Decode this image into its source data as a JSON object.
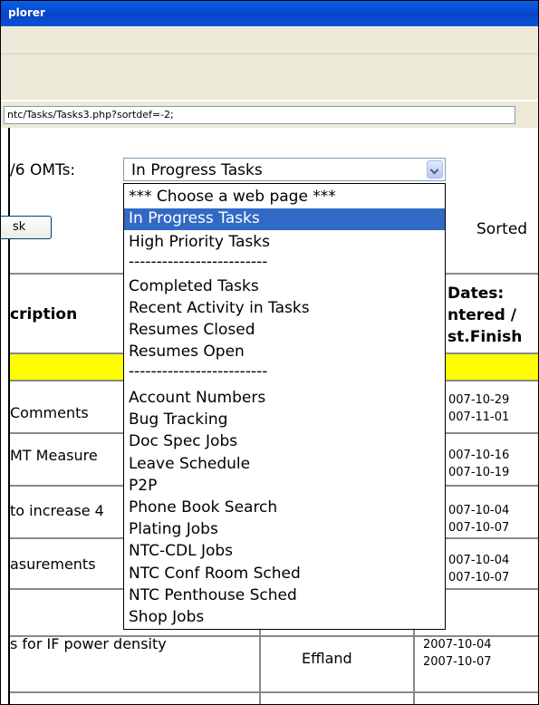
{
  "window": {
    "title": "plorer"
  },
  "address": {
    "url": "ntc/Tasks/Tasks3.php?sortdef=-2;"
  },
  "page": {
    "heading": "/6 OMTs:",
    "select_value": "In Progress Tasks",
    "task_button": "sk",
    "sorted_label": "Sorted"
  },
  "table": {
    "headers": {
      "description": "cription",
      "dates_line1": "Dates:",
      "dates_line2": "ntered /",
      "dates_line3": "st.Finish"
    },
    "rows": [
      {
        "desc": "Comments",
        "d1": "007-10-29",
        "d2": "007-11-01"
      },
      {
        "desc": "MT Measure",
        "d1": "007-10-16",
        "d2": "007-10-19"
      },
      {
        "desc": "to increase 4",
        "d1": "007-10-04",
        "d2": "007-10-07"
      },
      {
        "desc": "asurements",
        "d1": "007-10-04",
        "d2": "007-10-07"
      },
      {
        "desc": "s for IF power density",
        "owner": "Effland",
        "d1": "2007-10-04",
        "d2": "2007-10-07"
      }
    ]
  },
  "dropdown": {
    "options": [
      "*** Choose a web page ***",
      "In Progress Tasks",
      "High Priority Tasks",
      "-------------------------",
      "Completed Tasks",
      "Recent Activity in Tasks",
      "Resumes Closed",
      "Resumes Open",
      "-------------------------",
      "Account Numbers",
      "Bug Tracking",
      "Doc Spec Jobs",
      "Leave Schedule",
      "P2P",
      "Phone Book Search",
      "Plating Jobs",
      "NTC-CDL Jobs",
      "NTC Conf Room Sched",
      "NTC Penthouse Sched",
      "Shop Jobs"
    ]
  },
  "icons": {
    "dropdown_arrow": "chevron-down-icon"
  },
  "colors": {
    "highlight": "#316ac5",
    "row_highlight": "#ffff00",
    "titlebar": "#0545c8"
  }
}
